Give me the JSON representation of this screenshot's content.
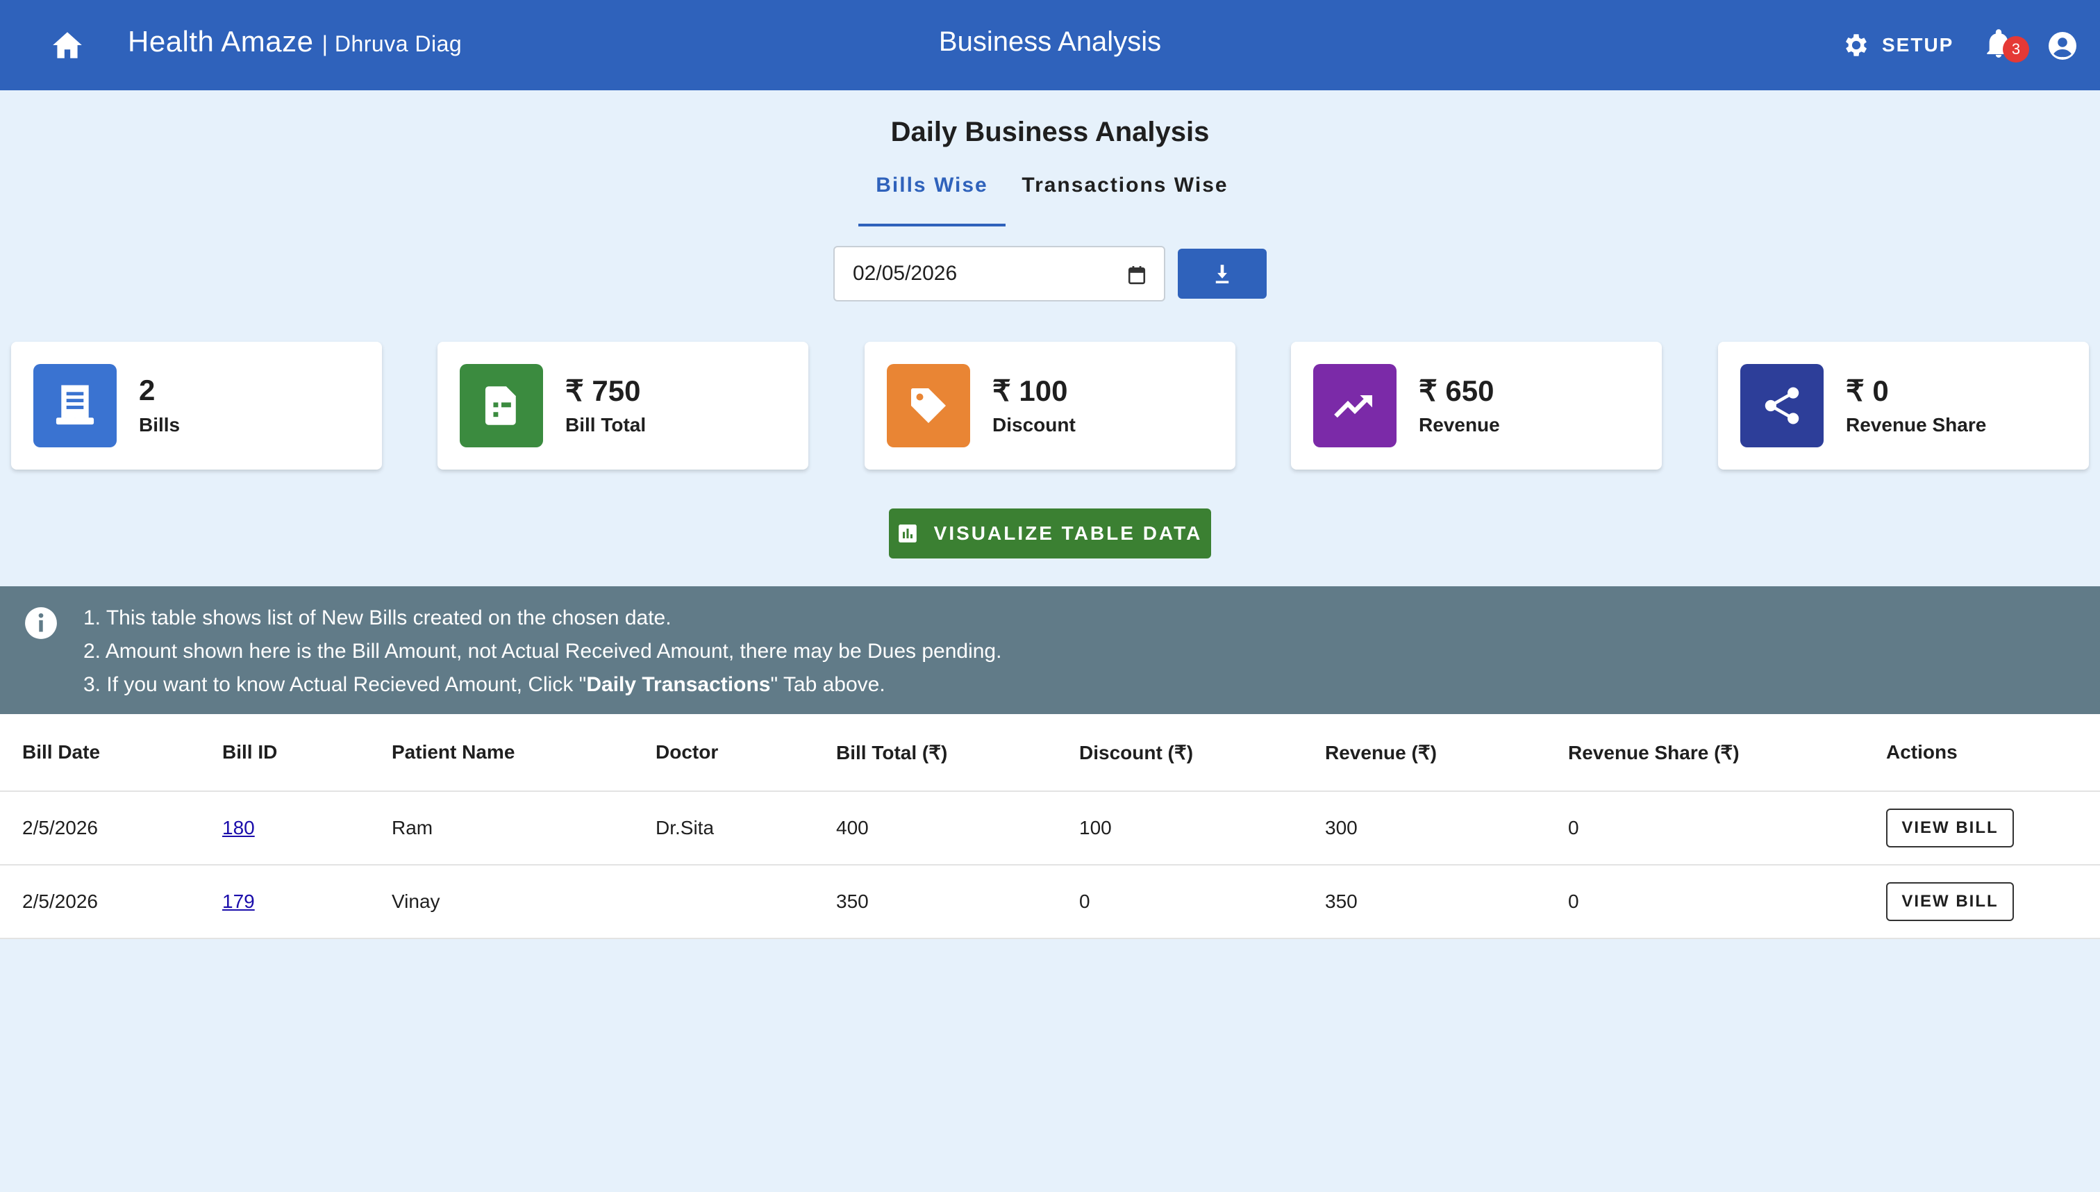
{
  "header": {
    "brand": "Health Amaze",
    "sub_brand": "| Dhruva Diag",
    "title": "Business Analysis",
    "setup_label": "SETUP",
    "notification_count": "3",
    "bar_color": "#2f62bb"
  },
  "page": {
    "title": "Daily Business Analysis",
    "tabs": [
      {
        "label": "Bills Wise",
        "active": true
      },
      {
        "label": "Transactions Wise",
        "active": false
      }
    ],
    "date_value": "02/05/2026"
  },
  "cards": [
    {
      "value": "2",
      "label": "Bills",
      "color": "#3a73d1",
      "icon": "receipt-icon"
    },
    {
      "value": "₹ 750",
      "label": "Bill Total",
      "color": "#3b8b3f",
      "icon": "document-icon"
    },
    {
      "value": "₹ 100",
      "label": "Discount",
      "color": "#e98534",
      "icon": "tag-icon"
    },
    {
      "value": "₹ 650",
      "label": "Revenue",
      "color": "#7b2aa8",
      "icon": "trending-up-icon"
    },
    {
      "value": "₹ 0",
      "label": "Revenue Share",
      "color": "#2d3e99",
      "icon": "share-icon"
    }
  ],
  "visualize_label": "VISUALIZE TABLE DATA",
  "info": {
    "line1": "1. This table shows list of New Bills created on the chosen date.",
    "line2": "2. Amount shown here is the Bill Amount, not Actual Received Amount, there may be Dues pending.",
    "line3_pre": "3. If you want to know Actual Recieved Amount, Click \"",
    "line3_bold": "Daily Transactions",
    "line3_post": "\" Tab above."
  },
  "table": {
    "headers": [
      "Bill Date",
      "Bill ID",
      "Patient Name",
      "Doctor",
      "Bill Total (₹)",
      "Discount (₹)",
      "Revenue (₹)",
      "Revenue Share (₹)",
      "Actions"
    ],
    "rows": [
      {
        "date": "2/5/2026",
        "id": "180",
        "patient": "Ram",
        "doctor": "Dr.Sita",
        "total": "400",
        "discount": "100",
        "revenue": "300",
        "share": "0",
        "action": "VIEW BILL"
      },
      {
        "date": "2/5/2026",
        "id": "179",
        "patient": "Vinay",
        "doctor": "",
        "total": "350",
        "discount": "0",
        "revenue": "350",
        "share": "0",
        "action": "VIEW BILL"
      }
    ]
  }
}
